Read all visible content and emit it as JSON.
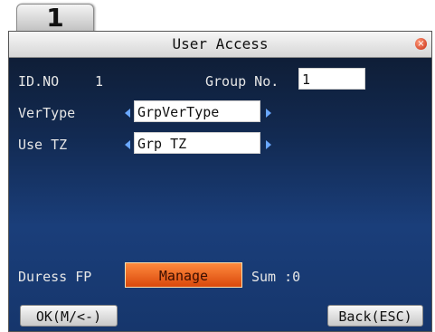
{
  "tab_number": "1",
  "window": {
    "title": "User Access"
  },
  "form": {
    "id_label": "ID.NO",
    "id_value": "1",
    "group_label": "Group No.",
    "group_value": "1",
    "vertype_label": "VerType",
    "vertype_value": "GrpVerType",
    "use_tz_label": "Use TZ",
    "use_tz_value": "Grp TZ",
    "duress_label": "Duress FP",
    "manage_label": "Manage",
    "sum_label": "Sum :0"
  },
  "buttons": {
    "ok": "OK(M/<-)",
    "back": "Back(ESC)"
  },
  "colors": {
    "screen_top": "#0e1a2e",
    "screen_bottom": "#1a3e7a",
    "manage_button": "#e85a1a",
    "arrow": "#6aa8ff"
  },
  "icons": {
    "close": "close-circle-icon",
    "arrow_left": "arrow-left-icon",
    "arrow_right": "arrow-right-icon"
  }
}
